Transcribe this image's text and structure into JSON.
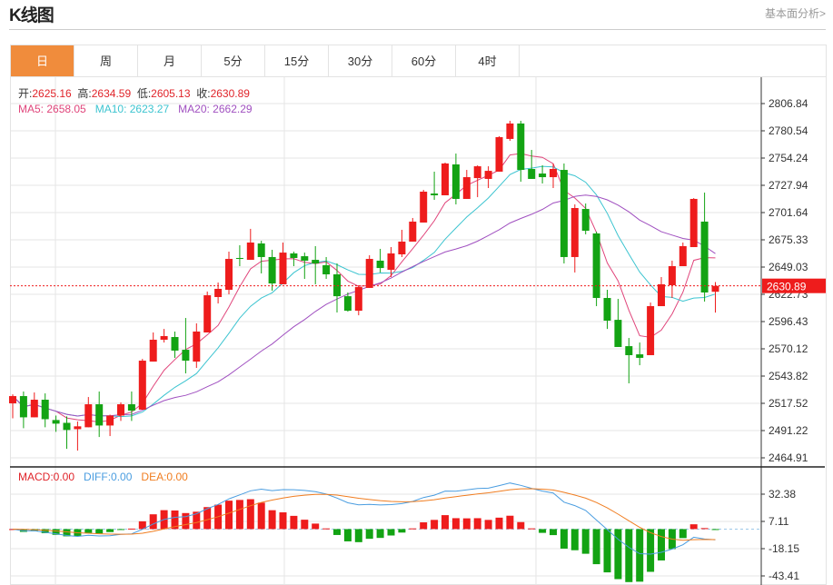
{
  "header": {
    "title": "K线图",
    "link": "基本面分析>"
  },
  "tabs": [
    {
      "label": "日",
      "active": true
    },
    {
      "label": "周"
    },
    {
      "label": "月"
    },
    {
      "label": "5分"
    },
    {
      "label": "15分"
    },
    {
      "label": "30分"
    },
    {
      "label": "60分"
    },
    {
      "label": "4时"
    }
  ],
  "ohlc_legend": {
    "open_label": "开:",
    "open": "2625.16",
    "high_label": "高:",
    "high": "2634.59",
    "low_label": "低:",
    "low": "2605.13",
    "close_label": "收:",
    "close": "2630.89"
  },
  "ma_legend": {
    "ma5": "MA5: 2658.05",
    "ma10": "MA10: 2623.27",
    "ma20": "MA20: 2662.29"
  },
  "macd_legend": {
    "macd": "MACD:0.00",
    "diff": "DIFF:0.00",
    "dea": "DEA:0.00"
  },
  "price_axis": [
    "2806.84",
    "2780.54",
    "2754.24",
    "2727.94",
    "2701.64",
    "2675.33",
    "2649.03",
    "2622.73",
    "2596.43",
    "2570.12",
    "2543.82",
    "2517.52",
    "2491.22",
    "2464.91"
  ],
  "current_price": "2630.89",
  "macd_axis": [
    "32.38",
    "7.11",
    "-18.15",
    "-43.41"
  ],
  "colors": {
    "up": "#ee1c1c",
    "down": "#13a313",
    "ma5": "#e0457b",
    "ma10": "#3cc4d0",
    "ma20": "#a050c0",
    "diff": "#4a9de0",
    "dea": "#f07d20",
    "tab_active": "#f08c3c"
  },
  "chart_data": {
    "type": "candlestick",
    "price_range": [
      2464.91,
      2806.84
    ],
    "macd_range": [
      -43.41,
      32.38
    ],
    "candles_ohlc": [
      [
        2517.5,
        2526.2,
        2503.1,
        2524.5
      ],
      [
        2524.5,
        2528.9,
        2493.5,
        2504.0
      ],
      [
        2504.0,
        2528.0,
        2504.0,
        2521.0
      ],
      [
        2521.0,
        2527.1,
        2494.4,
        2502.2
      ],
      [
        2501.4,
        2505.7,
        2490.0,
        2497.9
      ],
      [
        2498.7,
        2504.9,
        2473.6,
        2491.8
      ],
      [
        2492.6,
        2500.0,
        2471.9,
        2495.3
      ],
      [
        2494.4,
        2523.6,
        2494.4,
        2516.6
      ],
      [
        2516.6,
        2528.9,
        2485.0,
        2496.1
      ],
      [
        2496.1,
        2506.6,
        2485.9,
        2505.7
      ],
      [
        2505.7,
        2518.4,
        2500.5,
        2516.6
      ],
      [
        2516.6,
        2528.9,
        2500.5,
        2510.5
      ],
      [
        2511.4,
        2560.4,
        2511.4,
        2558.7
      ],
      [
        2557.8,
        2585.9,
        2557.8,
        2578.9
      ],
      [
        2578.9,
        2589.3,
        2576.2,
        2582.4
      ],
      [
        2581.5,
        2586.8,
        2561.4,
        2568.4
      ],
      [
        2569.2,
        2599.9,
        2546.4,
        2558.7
      ],
      [
        2557.8,
        2594.7,
        2551.7,
        2586.8
      ],
      [
        2585.9,
        2625.4,
        2585.9,
        2621.8
      ],
      [
        2620.1,
        2634.1,
        2613.9,
        2628.0
      ],
      [
        2627.1,
        2663.9,
        2622.7,
        2656.9
      ],
      [
        2657.8,
        2670.1,
        2649.9,
        2656.9
      ],
      [
        2656.0,
        2685.9,
        2656.0,
        2672.7
      ],
      [
        2671.8,
        2674.4,
        2642.9,
        2658.7
      ],
      [
        2658.7,
        2665.7,
        2626.2,
        2633.2
      ],
      [
        2632.4,
        2672.7,
        2632.4,
        2663.0
      ],
      [
        2662.2,
        2663.9,
        2649.9,
        2657.8
      ],
      [
        2659.5,
        2663.0,
        2637.6,
        2655.2
      ],
      [
        2656.0,
        2669.2,
        2632.4,
        2652.5
      ],
      [
        2650.8,
        2658.7,
        2637.6,
        2642.0
      ],
      [
        2642.0,
        2652.5,
        2605.2,
        2620.9
      ],
      [
        2620.9,
        2624.5,
        2606.0,
        2606.9
      ],
      [
        2606.9,
        2631.5,
        2602.5,
        2629.7
      ],
      [
        2628.9,
        2660.4,
        2628.9,
        2656.9
      ],
      [
        2655.2,
        2666.6,
        2643.8,
        2648.1
      ],
      [
        2646.4,
        2668.3,
        2639.4,
        2662.2
      ],
      [
        2661.3,
        2685.0,
        2658.7,
        2673.6
      ],
      [
        2673.6,
        2696.4,
        2673.6,
        2692.9
      ],
      [
        2692.0,
        2723.5,
        2692.0,
        2721.8
      ],
      [
        2720.0,
        2741.1,
        2713.9,
        2718.3
      ],
      [
        2718.3,
        2749.9,
        2718.3,
        2749.0
      ],
      [
        2748.1,
        2758.6,
        2709.5,
        2714.8
      ],
      [
        2714.8,
        2742.8,
        2714.8,
        2735.8
      ],
      [
        2734.9,
        2747.2,
        2716.5,
        2746.3
      ],
      [
        2734.1,
        2746.3,
        2725.3,
        2741.9
      ],
      [
        2741.1,
        2775.3,
        2741.1,
        2774.4
      ],
      [
        2772.7,
        2790.2,
        2770.9,
        2787.6
      ],
      [
        2787.6,
        2790.2,
        2731.4,
        2742.8
      ],
      [
        2743.7,
        2762.1,
        2734.1,
        2734.1
      ],
      [
        2739.3,
        2747.2,
        2729.7,
        2735.8
      ],
      [
        2735.8,
        2749.0,
        2725.3,
        2743.7
      ],
      [
        2742.8,
        2749.0,
        2652.5,
        2658.7
      ],
      [
        2658.7,
        2709.5,
        2643.8,
        2706.0
      ],
      [
        2705.1,
        2710.4,
        2680.6,
        2684.1
      ],
      [
        2681.5,
        2683.2,
        2611.3,
        2619.2
      ],
      [
        2619.2,
        2627.1,
        2589.3,
        2597.3
      ],
      [
        2598.1,
        2618.3,
        2571.9,
        2571.9
      ],
      [
        2572.7,
        2580.6,
        2536.8,
        2564.0
      ],
      [
        2564.8,
        2576.2,
        2554.3,
        2561.4
      ],
      [
        2564.0,
        2614.8,
        2564.0,
        2611.3
      ],
      [
        2611.3,
        2639.4,
        2611.3,
        2632.4
      ],
      [
        2631.5,
        2655.2,
        2619.2,
        2649.9
      ],
      [
        2649.9,
        2672.7,
        2649.9,
        2669.2
      ],
      [
        2668.3,
        2715.6,
        2668.3,
        2714.8
      ],
      [
        2692.9,
        2720.9,
        2615.7,
        2624.5
      ],
      [
        2625.16,
        2634.59,
        2605.13,
        2630.89
      ]
    ],
    "grid": true
  }
}
